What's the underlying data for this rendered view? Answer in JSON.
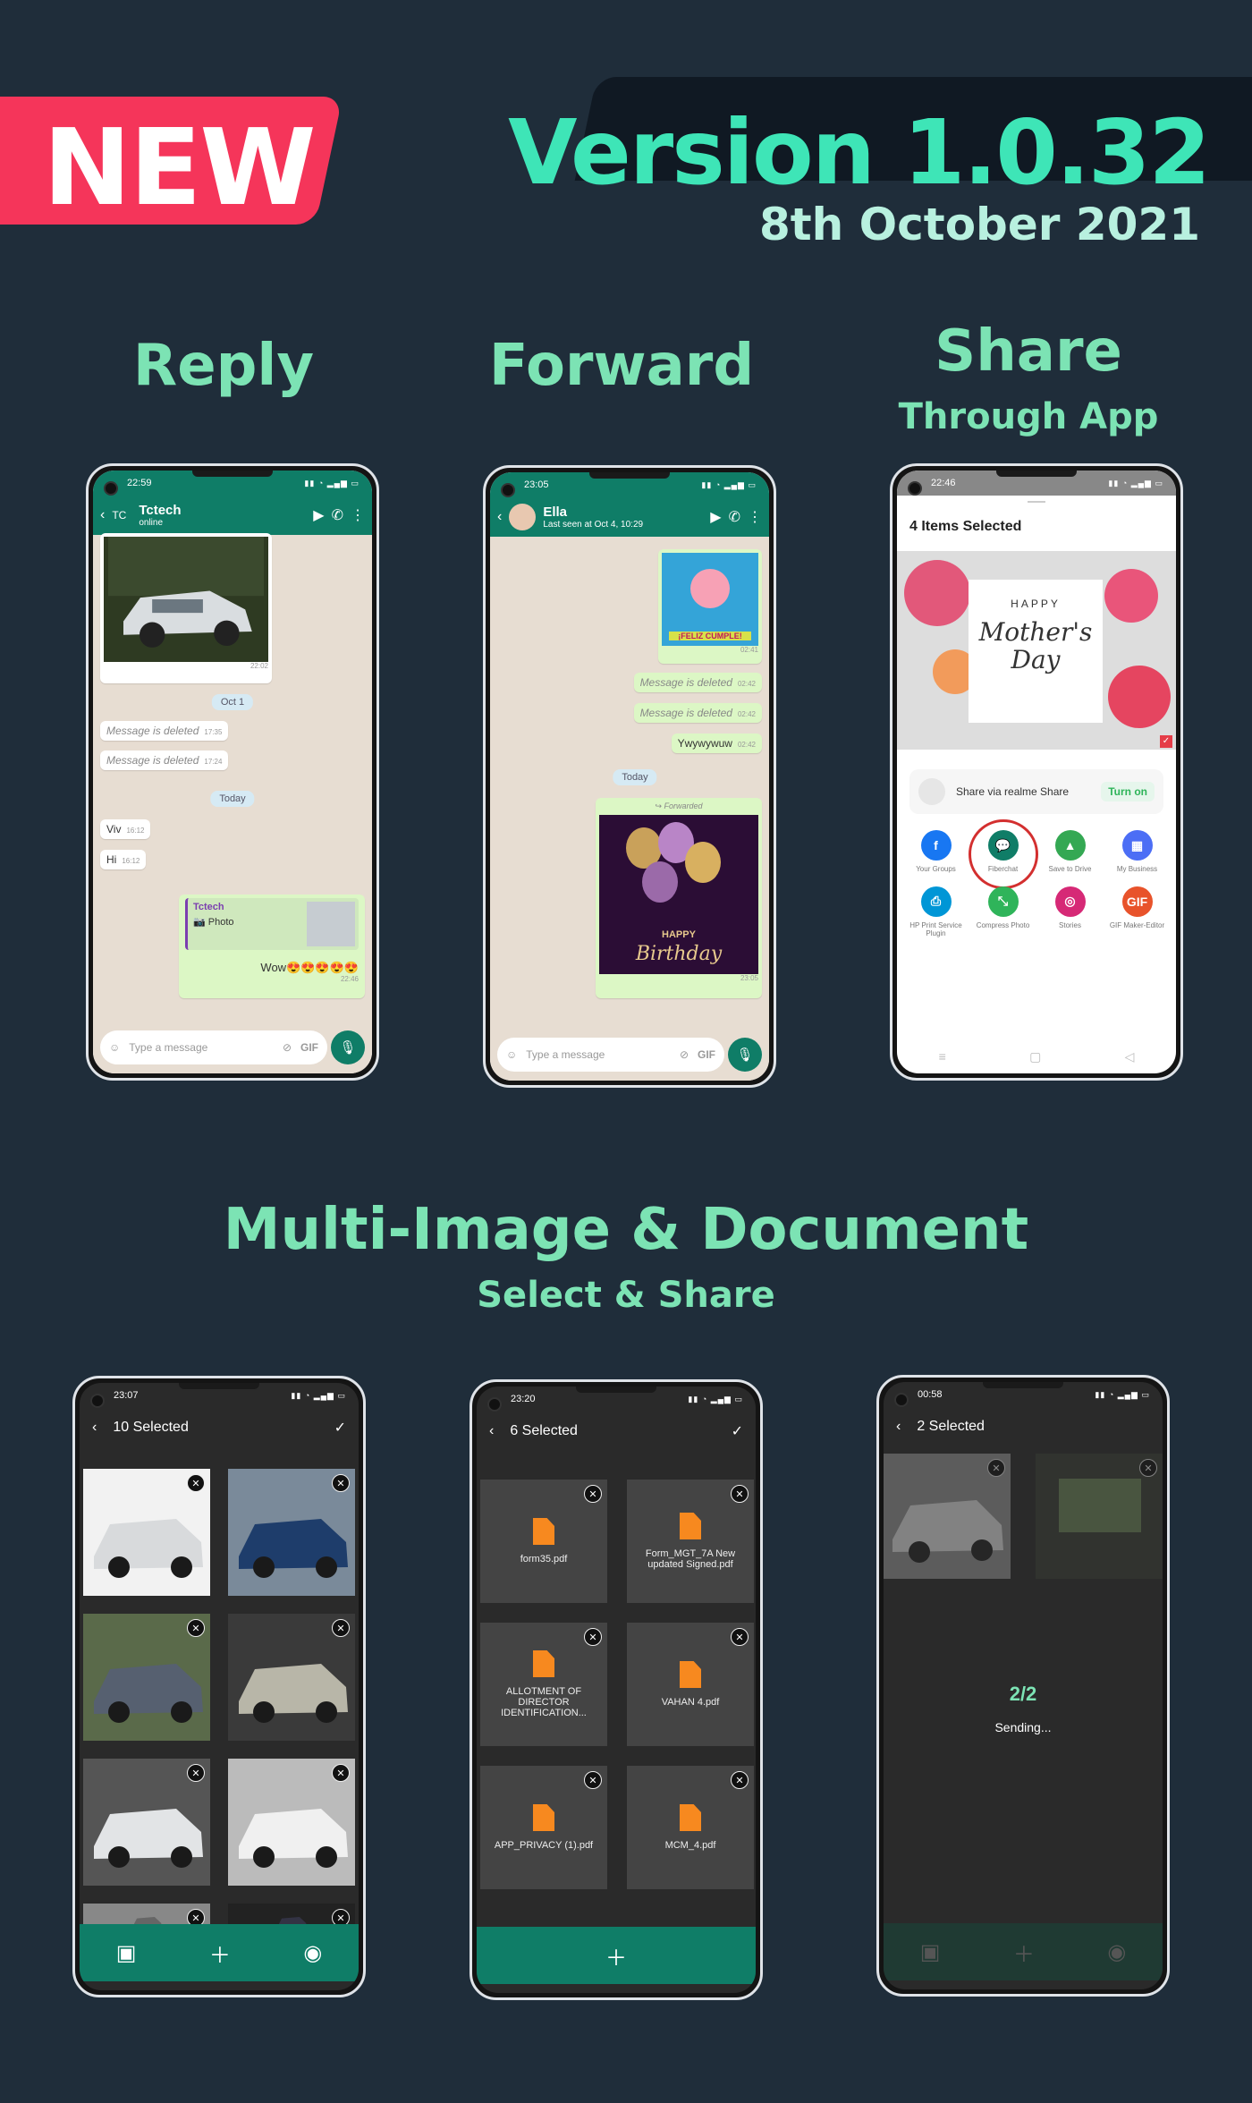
{
  "banner": {
    "new_label": "NEW",
    "version": "Version 1.0.32",
    "date": "8th October 2021"
  },
  "colors": {
    "background": "#1f2d3a",
    "accent": "#3ee5b7",
    "headline": "#7ce3b4",
    "badge": "#f5355a",
    "wa_green": "#0f7d67"
  },
  "sections": {
    "reply": "Reply",
    "forward": "Forward",
    "share_title": "Share",
    "share_sub": "Through App",
    "multi_title": "Multi-Image & Document",
    "multi_sub": "Select & Share"
  },
  "reply_phone": {
    "time": "22:59",
    "avatar": "TC",
    "name": "Tctech",
    "status": "online",
    "img_time": "22:02",
    "date1": "Oct 1",
    "deleted1": "Message is deleted",
    "deleted1_time": "17:35",
    "deleted2": "Message is deleted",
    "deleted2_time": "17:24",
    "date2": "Today",
    "msg1": "Viv",
    "msg1_time": "16:12",
    "msg2": "Hi",
    "msg2_time": "16:12",
    "quote_name": "Tctech",
    "quote_text": "📷 Photo",
    "reply_text": "Wow😍😍😍😍😍",
    "reply_time": "22:46",
    "placeholder": "Type a message",
    "gif": "GIF"
  },
  "forward_phone": {
    "time": "23:05",
    "name": "Ella",
    "status": "Last seen at Oct 4, 10:29",
    "sticker_caption": "¡FELIZ CUMPLE!",
    "sticker_time": "02:41",
    "deleted1": "Message is deleted",
    "deleted1_time": "02:42",
    "deleted2": "Message is deleted",
    "deleted2_time": "02:42",
    "msg": "Ywywywuw",
    "msg_time": "02:42",
    "date": "Today",
    "forwarded": "Forwarded",
    "card_line1": "HAPPY",
    "card_line2": "Birthday",
    "card_time": "23:05",
    "placeholder": "Type a message",
    "gif": "GIF"
  },
  "share_phone": {
    "time": "22:46",
    "title": "4 Items Selected",
    "card_happy": "HAPPY",
    "card_main": "Mother's Day",
    "share_via": "Share via realme Share",
    "turn_on": "Turn on",
    "apps": [
      {
        "label": "Your Groups",
        "icon": "facebook-icon",
        "glyph": "f",
        "color": "#1877f2"
      },
      {
        "label": "Fiberchat",
        "icon": "fiberchat-icon",
        "glyph": "💬",
        "color": "#0f7d67"
      },
      {
        "label": "Save to Drive",
        "icon": "drive-icon",
        "glyph": "▲",
        "color": "#34a853"
      },
      {
        "label": "My Business",
        "icon": "business-icon",
        "glyph": "▦",
        "color": "#4c6ef5"
      },
      {
        "label": "HP Print Service Plugin",
        "icon": "printer-icon",
        "glyph": "⎙",
        "color": "#0096d6"
      },
      {
        "label": "Compress Photo",
        "icon": "compress-icon",
        "glyph": "⤡",
        "color": "#2fb45a"
      },
      {
        "label": "Stories",
        "icon": "instagram-icon",
        "glyph": "◎",
        "color": "#d62976"
      },
      {
        "label": "GIF Maker-Editor",
        "icon": "gif-icon",
        "glyph": "GIF",
        "color": "#e8532b"
      }
    ]
  },
  "images_phone": {
    "time": "23:07",
    "title": "10 Selected"
  },
  "docs_phone": {
    "time": "23:20",
    "title": "6 Selected",
    "docs": [
      "form35.pdf",
      "Form_MGT_7A New updated Signed.pdf",
      "ALLOTMENT OF DIRECTOR IDENTIFICATION...",
      "VAHAN 4.pdf",
      "APP_PRIVACY (1).pdf",
      "MCM_4.pdf"
    ]
  },
  "sending_phone": {
    "time": "00:58",
    "title": "2 Selected",
    "progress": "2/2",
    "status": "Sending..."
  }
}
